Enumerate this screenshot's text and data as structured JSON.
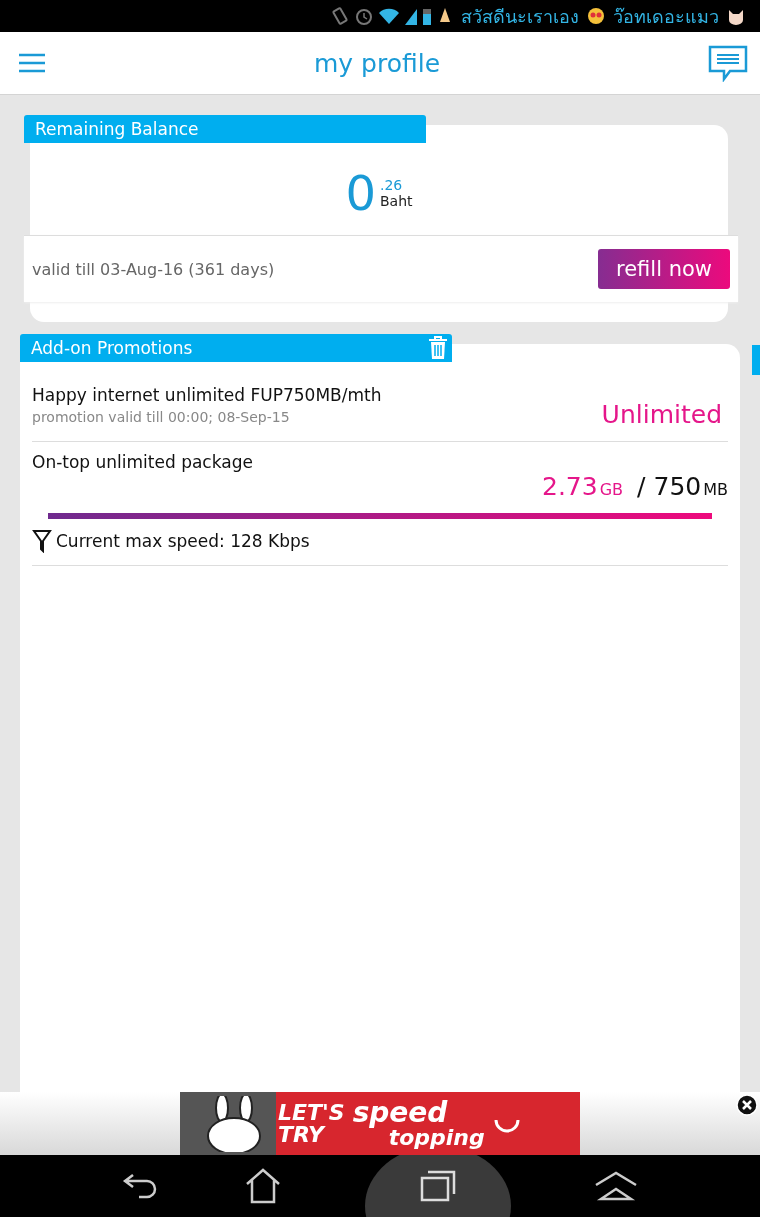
{
  "status_bar": {
    "notifications": [
      "สวัสดีนะเราเอง",
      "ว๊อทเดอะแมว"
    ]
  },
  "header": {
    "title": "my profile"
  },
  "balance": {
    "heading": "Remaining Balance",
    "integer": "0",
    "fraction": ".26",
    "currency": "Baht",
    "validity": "valid till 03-Aug-16 (361 days)",
    "button": "refill now"
  },
  "addons": {
    "heading": "Add-on Promotions",
    "items": [
      {
        "kind": "quota",
        "name": "Happy internet unlimited FUP750MB/mth",
        "detail": "promotion valid till 00:00; 08-Sep-15",
        "quota": "Unlimited"
      },
      {
        "kind": "usage",
        "name": "On-top unlimited package",
        "used": "2.73",
        "used_unit": "GB",
        "separator": "/",
        "total": "750",
        "total_unit": "MB",
        "speed": "Current max speed: 128 Kbps"
      }
    ]
  },
  "ad": {
    "line_1": "LET'S",
    "line_2": "TRY",
    "line_3": "speed",
    "line_4": "topping"
  }
}
